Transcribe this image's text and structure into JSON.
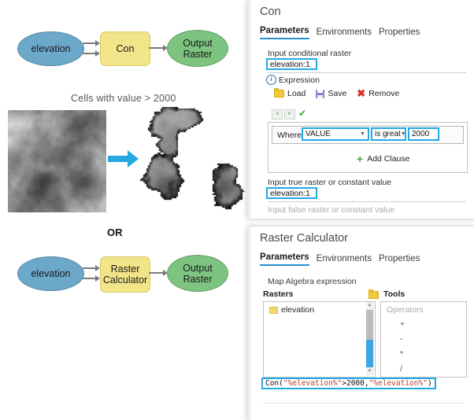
{
  "diagram": {
    "model_top": {
      "input_label": "elevation",
      "tool_label": "Con",
      "output_label": "Output\nRaster"
    },
    "or_label": "OR",
    "model_bottom": {
      "input_label": "elevation",
      "tool_label": "Raster\nCalculator",
      "output_label": "Output\nRaster"
    },
    "raster_caption": "Cells with value > 2000",
    "input_raster_name": "elevation DEM grayscale hillshade",
    "output_raster_name": "cells above 2000 extracted patches"
  },
  "con_panel": {
    "title": "Con",
    "tabs": [
      {
        "label": "Parameters",
        "active": true
      },
      {
        "label": "Environments",
        "active": false
      },
      {
        "label": "Properties",
        "active": false
      }
    ],
    "input_conditional_raster": {
      "label": "Input conditional raster",
      "value": "elevation:1"
    },
    "expression": {
      "label": "Expression",
      "info_icon": "info-icon",
      "commands": [
        {
          "label": "Load",
          "icon": "folder-open-icon"
        },
        {
          "label": "Save",
          "icon": "floppy-disk-icon"
        },
        {
          "label": "Remove",
          "icon": "red-x-icon"
        }
      ],
      "nav": {
        "prev": "◂",
        "next": "▸",
        "validate": "✔"
      },
      "clause": {
        "where_label": "Where",
        "field": "VALUE",
        "operator": "is great",
        "value": "2000"
      },
      "add_clause_label": "Add Clause"
    },
    "input_true_raster": {
      "label": "Input true raster or constant value",
      "value": "elevation:1"
    },
    "input_false_raster": {
      "label": "Input false raster or constant value",
      "value": ""
    }
  },
  "rc_panel": {
    "title": "Raster Calculator",
    "tabs": [
      {
        "label": "Parameters",
        "active": true
      },
      {
        "label": "Environments",
        "active": false
      },
      {
        "label": "Properties",
        "active": false
      }
    ],
    "map_algebra_label": "Map Algebra expression",
    "rasters_label": "Rasters",
    "tools_label": "Tools",
    "tools_folder_icon": "folder-open-icon",
    "raster_items": [
      {
        "label": "elevation",
        "icon": "raster-layer-icon"
      }
    ],
    "operators_placeholder": "Operators",
    "operators": [
      "+",
      "-",
      "*",
      "/"
    ],
    "formula": {
      "prefix": "Con(",
      "arg1": "\"%elevation%\"",
      "mid": ">2000,",
      "arg2": "\"%elevation%\"",
      "suffix": ")",
      "full": "Con(\"%elevation%\">2000,\"%elevation%\")"
    }
  },
  "colors": {
    "highlight": "#22aae6",
    "accent_tab": "#2e8fd4",
    "oval_input": "#6ba8ca",
    "oval_output": "#7cc47f",
    "tool_rect": "#f2e489",
    "arrow_blue": "#27a8e0"
  }
}
